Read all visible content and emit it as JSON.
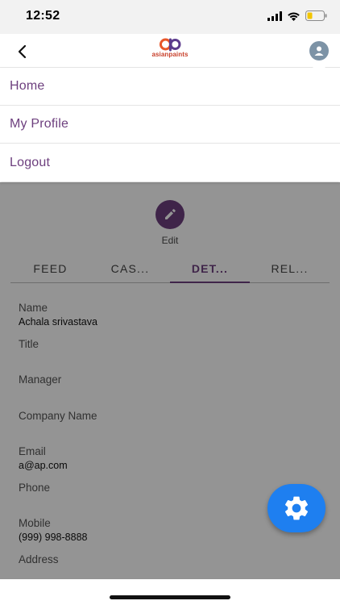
{
  "status": {
    "time": "12:52"
  },
  "header": {
    "logo_text": "asianpaints"
  },
  "menu": {
    "items": [
      {
        "label": "Home"
      },
      {
        "label": "My Profile"
      },
      {
        "label": "Logout"
      }
    ]
  },
  "edit": {
    "label": "Edit"
  },
  "tabs": [
    {
      "label": "FEED",
      "active": false
    },
    {
      "label": "CAS...",
      "active": false
    },
    {
      "label": "DET...",
      "active": true
    },
    {
      "label": "REL...",
      "active": false
    }
  ],
  "details": [
    {
      "label": "Name",
      "value": "Achala srivastava"
    },
    {
      "label": "Title",
      "value": ""
    },
    {
      "label": "Manager",
      "value": ""
    },
    {
      "label": "Company Name",
      "value": ""
    },
    {
      "label": "Email",
      "value": "a@ap.com"
    },
    {
      "label": "Phone",
      "value": ""
    },
    {
      "label": "Mobile",
      "value": "(999) 998-8888"
    },
    {
      "label": "Address",
      "value": ""
    }
  ],
  "colors": {
    "brand_purple": "#6d3f7e",
    "fab_blue": "#1e7ff0",
    "logo_orange": "#c8402b",
    "logo_purple": "#5b3a8c"
  }
}
